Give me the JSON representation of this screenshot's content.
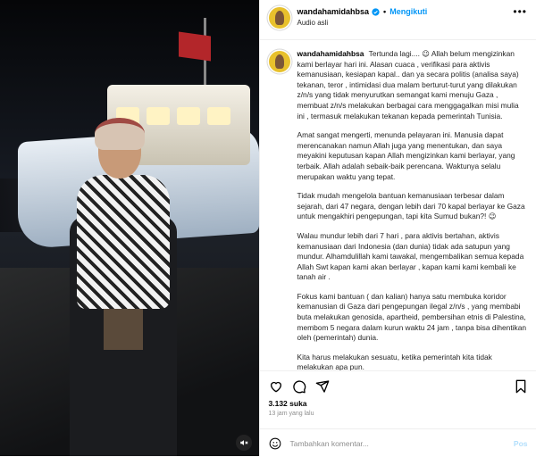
{
  "post": {
    "username": "wandahamidahbsa",
    "follow_label": "Mengikuti",
    "audio_label": "Audio asli",
    "dot": "•",
    "more": "•••",
    "mute_icon": "speaker-muted-icon"
  },
  "caption": {
    "author": "wandahamidahbsa",
    "paragraphs": [
      "Tertunda lagi.... 😉 Allah belum mengizinkan kami berlayar hari ini. Alasan cuaca , verifikasi para aktivis kemanusiaan, kesiapan kapal.. dan ya secara politis (analisa saya) tekanan, teror , intimidasi dua malam berturut-turut yang dilakukan z/n/s yang tidak menyurutkan semangat kami menuju Gaza , membuat z/n/s melakukan berbagai cara menggagalkan misi mulia ini , termasuk melakukan tekanan kepada pemerintah Tunisia.",
      "Amat sangat mengerti, menunda pelayaran ini. Manusia dapat merencanakan namun Allah juga yang menentukan, dan saya meyakini keputusan kapan Allah mengizinkan kami berlayar, yang terbaik. Allah adalah sebaik-baik perencana. Waktunya selalu merupakan waktu yang tepat.",
      "Tidak mudah mengelola bantuan kemanusiaan terbesar dalam sejarah, dari 47 negara, dengan lebih dari 70 kapal berlayar ke Gaza untuk mengakhiri pengepungan, tapi kita Sumud bukan?! 😉",
      "Walau mundur lebih dari 7 hari , para aktivis bertahan, aktivis kemanusiaan dari Indonesia (dan dunia) tidak ada satupun yang mundur. Alhamdulillah kami tawakal, mengembalikan semua kepada Allah Swt kapan kami akan berlayar , kapan kami kami kembali ke tanah air .",
      "Fokus kami bantuan ( dan kalian) hanya satu membuka koridor kemanusian di Gaza dari pengepungan ilegal z/n/s , yang membabi buta melakukan genosida, apartheid, pembersihan etnis di Palestina, membom 5 negara dalam kurun waktu 24 jam , tanpa bisa dihentikan oleh (pemerintah) dunia.",
      "Kita harus melakukan sesuatu, ketika pemerintah kita tidak melakukan apa pun."
    ]
  },
  "engagement": {
    "likes": "3.132 suka",
    "time": "13 jam yang lalu"
  },
  "comment": {
    "placeholder": "Tambahkan komentar...",
    "post_label": "Pos"
  }
}
